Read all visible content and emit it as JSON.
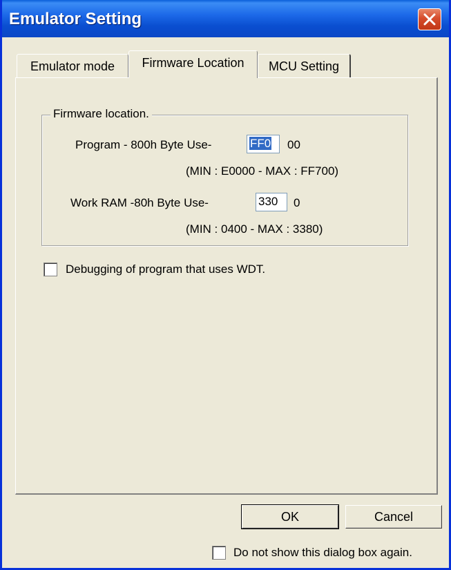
{
  "window": {
    "title": "Emulator Setting"
  },
  "tabs": [
    {
      "label": "Emulator mode"
    },
    {
      "label": "Firmware Location"
    },
    {
      "label": "MCU Setting"
    }
  ],
  "firmware": {
    "group_title": "Firmware location.",
    "program": {
      "label": "Program - 800h Byte Use-",
      "value": "FF0",
      "suffix": "00",
      "range": "(MIN : E0000  -  MAX : FF700)"
    },
    "work_ram": {
      "label": "Work RAM -80h Byte Use-",
      "value": "330",
      "suffix": "0",
      "range": "(MIN : 0400  -  MAX : 3380)"
    }
  },
  "wdt_option": {
    "label": "Debugging of program that uses WDT.",
    "checked": false
  },
  "buttons": {
    "ok": "OK",
    "cancel": "Cancel"
  },
  "dont_show": {
    "label": "Do not show this dialog box again.",
    "checked": false
  },
  "colors": {
    "titlebar": "#0a4ed0",
    "close_button": "#d64c2c",
    "dialog_bg": "#ece9d8",
    "selection": "#316ac5"
  }
}
